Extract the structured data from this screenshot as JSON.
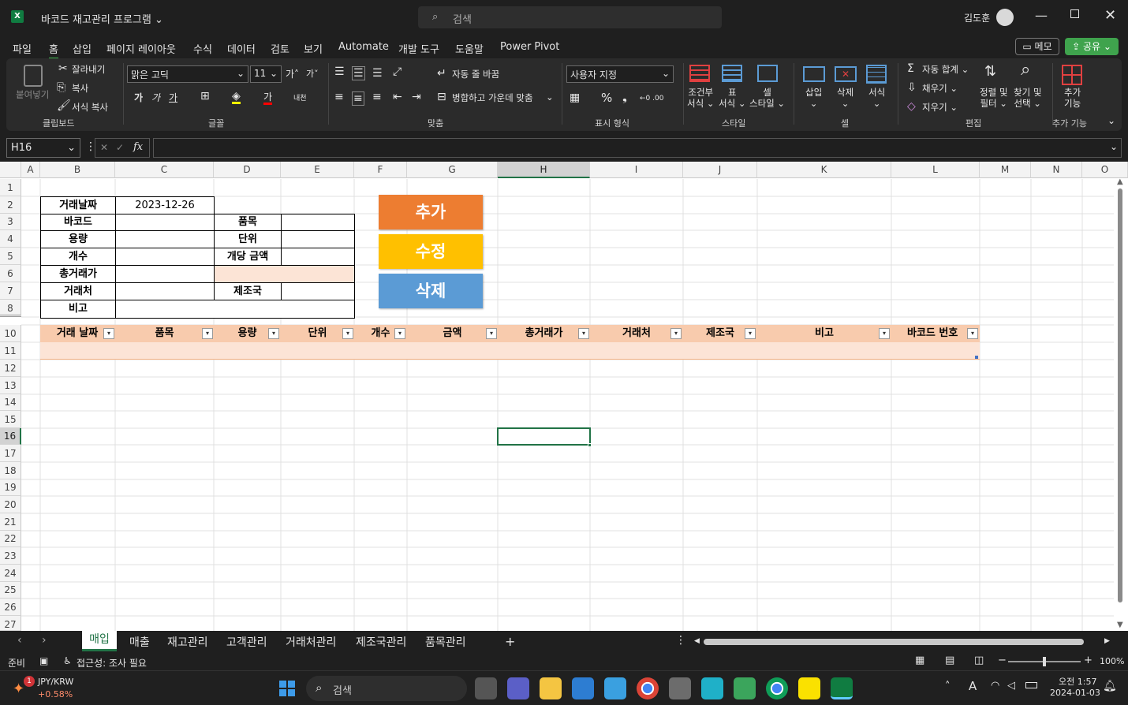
{
  "window": {
    "title": "바코드 재고관리 프로그램",
    "search_placeholder": "검색",
    "user_name": "김도훈"
  },
  "menu": {
    "items": [
      "파일",
      "홈",
      "삽입",
      "페이지 레이아웃",
      "수식",
      "데이터",
      "검토",
      "보기",
      "Automate",
      "개발 도구",
      "도움말",
      "Power Pivot"
    ],
    "memo_button": "메모",
    "share_button": "공유"
  },
  "ribbon": {
    "clipboard": {
      "paste": "붙여넣기",
      "cut": "잘라내기",
      "copy": "복사",
      "format_painter": "서식 복사",
      "group": "클립보드"
    },
    "font": {
      "name": "맑은 고딕",
      "size": "11",
      "group": "글꼴",
      "bold": "가",
      "italic": "가",
      "underline": "가",
      "font_color": "가",
      "phonetic": "내천"
    },
    "alignment": {
      "wrap_text": "자동 줄 바꿈",
      "merge_center": "병합하고 가운데 맞춤",
      "group": "맞춤"
    },
    "number": {
      "format": "사용자 지정",
      "group": "표시 형식"
    },
    "styles": {
      "conditional": [
        "조건부",
        "서식"
      ],
      "table": [
        "표",
        "서식"
      ],
      "cell": [
        "셀",
        "스타일"
      ],
      "group": "스타일"
    },
    "cells": {
      "insert": "삽입",
      "delete": "삭제",
      "format": "서식",
      "group": "셀"
    },
    "editing": {
      "autosum": "자동 합계",
      "fill": "채우기",
      "clear": "지우기",
      "sort": [
        "정렬 및",
        "필터"
      ],
      "find": [
        "찾기 및",
        "선택"
      ],
      "group": "편집"
    },
    "addins": {
      "label": [
        "추가",
        "기능"
      ],
      "group": "추가 기능"
    }
  },
  "formula_bar": {
    "name_box": "H16",
    "fx": "fx",
    "formula": ""
  },
  "columns": [
    "A",
    "B",
    "C",
    "D",
    "E",
    "F",
    "G",
    "H",
    "I",
    "J",
    "K",
    "L",
    "M",
    "N",
    "O"
  ],
  "rows": [
    "1",
    "2",
    "3",
    "4",
    "5",
    "6",
    "7",
    "8",
    "10",
    "11",
    "12",
    "13",
    "14",
    "15",
    "16",
    "17",
    "18",
    "19",
    "20",
    "21",
    "22",
    "23",
    "24",
    "25",
    "26",
    "27"
  ],
  "form": {
    "labels_b": [
      "거래날짜",
      "바코드",
      "용량",
      "개수",
      "총거래가",
      "거래처",
      "비고"
    ],
    "date_value": "2023-12-26",
    "labels_d": [
      "품목",
      "단위",
      "개당 금액",
      "제조국"
    ]
  },
  "buttons": {
    "add": "추가",
    "edit": "수정",
    "delete": "삭제",
    "add_color": "#ed7d31",
    "edit_color": "#ffc000",
    "delete_color": "#5b9bd5"
  },
  "table_headers": [
    "거래 날짜",
    "품목",
    "용량",
    "단위",
    "개수",
    "금액",
    "총거래가",
    "거래처",
    "제조국",
    "비고",
    "바코드 번호"
  ],
  "sheets": [
    "매입",
    "매출",
    "재고관리",
    "고객관리",
    "거래처관리",
    "제조국관리",
    "품목관리"
  ],
  "status": {
    "ready": "준비",
    "accessibility": "접근성: 조사 필요",
    "zoom": "100%"
  },
  "taskbar": {
    "ticker": "JPY/KRW",
    "ticker_change": "+0.58%",
    "search": "검색",
    "time": "오전 1:57",
    "date": "2024-01-03"
  }
}
